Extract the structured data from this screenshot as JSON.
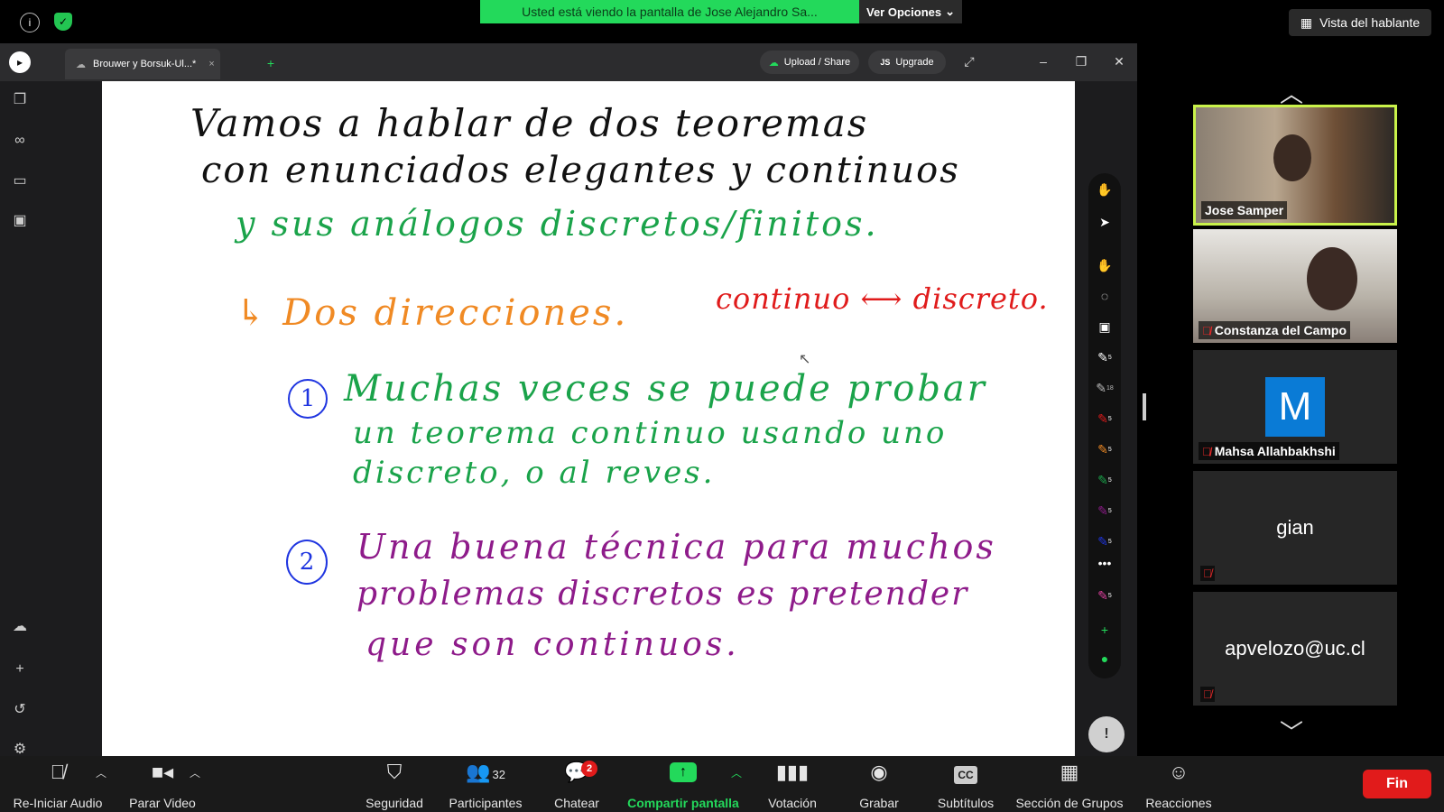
{
  "top": {
    "share_banner": "Usted está viendo la pantalla de Jose Alejandro Sa...",
    "view_options": "Ver Opciones",
    "speaker_view": "Vista del hablante"
  },
  "app": {
    "tab_title": "Brouwer y Borsuk-Ul...*",
    "upload_share": "Upload / Share",
    "upgrade": "Upgrade",
    "upgrade_badge": "JS"
  },
  "notes": {
    "line1": "Vamos a hablar de dos teoremas",
    "line2": "con enunciados elegantes y continuos",
    "line3": "y sus análogos discretos/finitos.",
    "line4a": "↳ Dos direcciones.",
    "line4b": "continuo ⟷ discreto.",
    "item1_num": "1",
    "item1_l1": "Muchas veces se puede probar",
    "item1_l2": "un teorema continuo usando uno",
    "item1_l3": "discreto, o al reves.",
    "item2_num": "2",
    "item2_l1": "Una buena técnica para muchos",
    "item2_l2": "problemas discretos es pretender",
    "item2_l3": "que son continuos."
  },
  "colors": {
    "black_ink": "#111111",
    "green_ink": "#1aa34a",
    "orange_ink": "#f08a24",
    "red_ink": "#e01b1b",
    "blue_ink": "#1f35e0",
    "purple_ink": "#8e1b8a",
    "active_speaker": "#c9f24a"
  },
  "rail_badges": [
    "5",
    "18",
    "5",
    "5",
    "5",
    "5",
    "5",
    "5"
  ],
  "participants": [
    {
      "name": "Jose Samper"
    },
    {
      "name": "Constanza del Campo"
    },
    {
      "name": "Mahsa Allahbakhshi",
      "avatar": "M"
    },
    {
      "name": "gian"
    },
    {
      "name": "apvelozo@uc.cl"
    }
  ],
  "toolbar": {
    "audio": "Re-Iniciar Audio",
    "video": "Parar Video",
    "security": "Seguridad",
    "participants": "Participantes",
    "participants_count": "32",
    "chat": "Chatear",
    "chat_badge": "2",
    "share": "Compartir pantalla",
    "poll": "Votación",
    "record": "Grabar",
    "subtitles": "Subtítulos",
    "cc": "CC",
    "breakout": "Sección de Grupos",
    "reactions": "Reacciones",
    "end": "Fin"
  }
}
